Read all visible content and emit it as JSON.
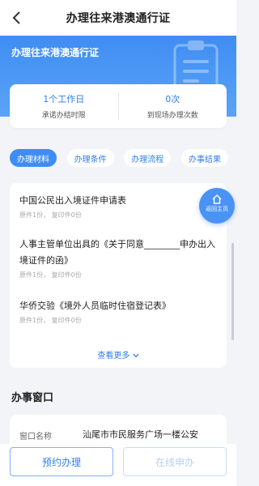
{
  "nav": {
    "title": "办理往来港澳通行证",
    "back_icon": "chevron-left-icon"
  },
  "banner": {
    "title": "办理往来港澳通行证",
    "deco_icon": "clipboard-icon"
  },
  "stats": [
    {
      "value": "1个工作日",
      "label": "承诺办结时限"
    },
    {
      "value": "0次",
      "label": "到现场办理次数"
    }
  ],
  "tabs": [
    {
      "label": "办理材料",
      "active": true
    },
    {
      "label": "办理条件",
      "active": false
    },
    {
      "label": "办理流程",
      "active": false
    },
    {
      "label": "办事结果",
      "active": false
    }
  ],
  "materials": {
    "items": [
      {
        "name": "中国公民出入境证件申请表",
        "meta": "原件1份，  复印件0份"
      },
      {
        "name": "人事主管单位出具的《关于同意________申办出入境证件的函》",
        "meta": "原件1份，  复印件0份"
      },
      {
        "name": "华侨交验《境外人员临时住宿登记表》",
        "meta": "原件1份，  复印件0份"
      }
    ],
    "more": "查看更多"
  },
  "home_button": {
    "label": "返回主页",
    "icon": "home-icon"
  },
  "window_section": {
    "title": "办事窗口",
    "label": "窗口名称",
    "value": "汕尾市市民服务广场一楼公安"
  },
  "bottom": {
    "primary": "预约办理",
    "secondary": "在线申办"
  },
  "colors": {
    "accent": "#3f8df4",
    "text": "#222222",
    "muted": "#aaaaaa",
    "background": "#f2f4f7"
  }
}
